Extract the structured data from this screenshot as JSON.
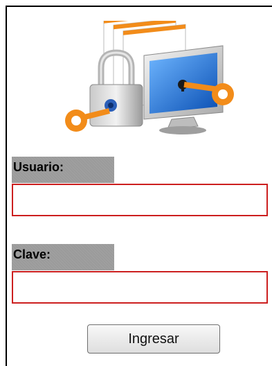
{
  "logo": {
    "icon": "security-lock-key-monitor-icon"
  },
  "form": {
    "user_label": "Usuario:",
    "user_value": "",
    "password_label": "Clave:",
    "password_value": "",
    "submit_label": "Ingresar"
  },
  "colors": {
    "field_border": "#cc1f1f",
    "label_background": "#9b9b9b",
    "key_orange": "#f28c1a"
  }
}
